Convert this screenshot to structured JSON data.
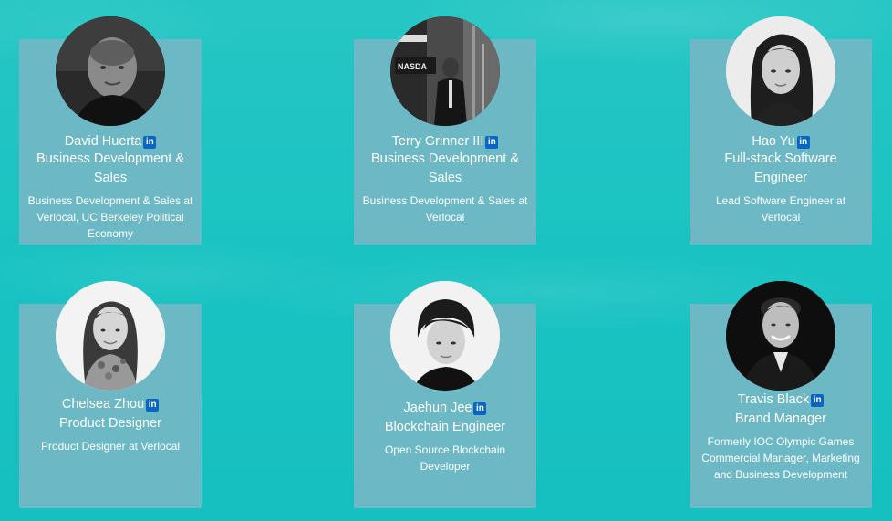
{
  "team": [
    {
      "name": "David Huerta",
      "role": "Business Development & Sales",
      "description": "Business Development & Sales at Verlocal, UC Berkeley Political Economy",
      "social_icon": "linkedin-icon",
      "social_label": "in"
    },
    {
      "name": "Terry Grinner III",
      "role": "Business Development & Sales",
      "description": "Business Development & Sales at Verlocal",
      "social_icon": "linkedin-icon",
      "social_label": "in"
    },
    {
      "name": "Hao Yu",
      "role": "Full-stack Software Engineer",
      "description": "Lead Software Engineer at Verlocal",
      "social_icon": "linkedin-icon",
      "social_label": "in"
    },
    {
      "name": "Chelsea Zhou",
      "role": "Product Designer",
      "description": "Product Designer at Verlocal",
      "social_icon": "linkedin-icon",
      "social_label": "in"
    },
    {
      "name": "Jaehun Jee",
      "role": "Blockchain Engineer",
      "description": "Open Source Blockchain Developer",
      "social_icon": "linkedin-icon",
      "social_label": "in"
    },
    {
      "name": "Travis Black",
      "role": "Brand Manager",
      "description": "Formerly IOC Olympic Games Commercial Manager, Marketing and Business Development",
      "social_icon": "linkedin-icon",
      "social_label": "in"
    }
  ],
  "colors": {
    "background": "#19c3c2",
    "card": "#6cb8c4",
    "text": "#ffffff",
    "linkedin": "#0a66c2"
  }
}
